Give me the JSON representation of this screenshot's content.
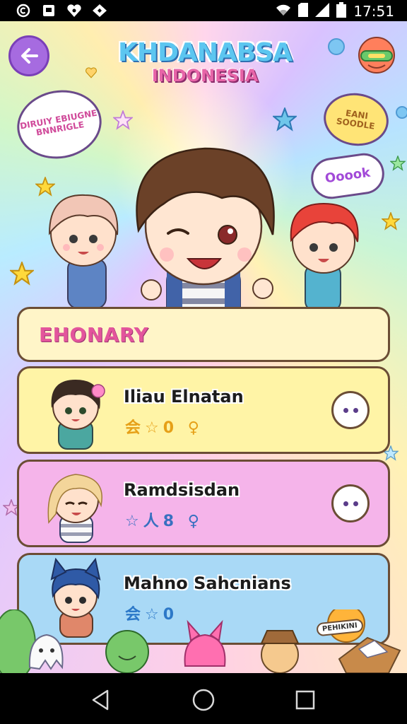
{
  "status_bar": {
    "time": "17:51",
    "left_icons": [
      "notification-c-icon",
      "notification-square-icon",
      "notification-heart-icon",
      "notification-diamond-icon"
    ],
    "right_icons": [
      "wifi-icon",
      "sim-icon",
      "signal-icon",
      "battery-icon"
    ]
  },
  "header": {
    "title": "KHDANABSA",
    "subtitle": "INDONESIA"
  },
  "bubbles": {
    "left": "DIRUIY EBIUGNE BNNRIGLE",
    "right": "EANI SOODLE",
    "ooh": "Ooook"
  },
  "section": {
    "title": "EHONARY"
  },
  "cards": [
    {
      "name": "Iliau Elnatan",
      "meta": "会☆0 ♀"
    },
    {
      "name": "Ramdsisdan",
      "meta": "☆人8 ♀"
    },
    {
      "name": "Mahno Sahcnians",
      "meta": "会☆0"
    }
  ],
  "bottom_sign": "PEHIKINI",
  "colors": {
    "accent_purple": "#a66be0",
    "panel_header": "#fff5c8",
    "card_yellow": "#fff4a6",
    "card_pink": "#f5b4ea",
    "card_blue": "#a9d9f6",
    "title_pink": "#e3559c",
    "border_brown": "#6b4d35"
  }
}
